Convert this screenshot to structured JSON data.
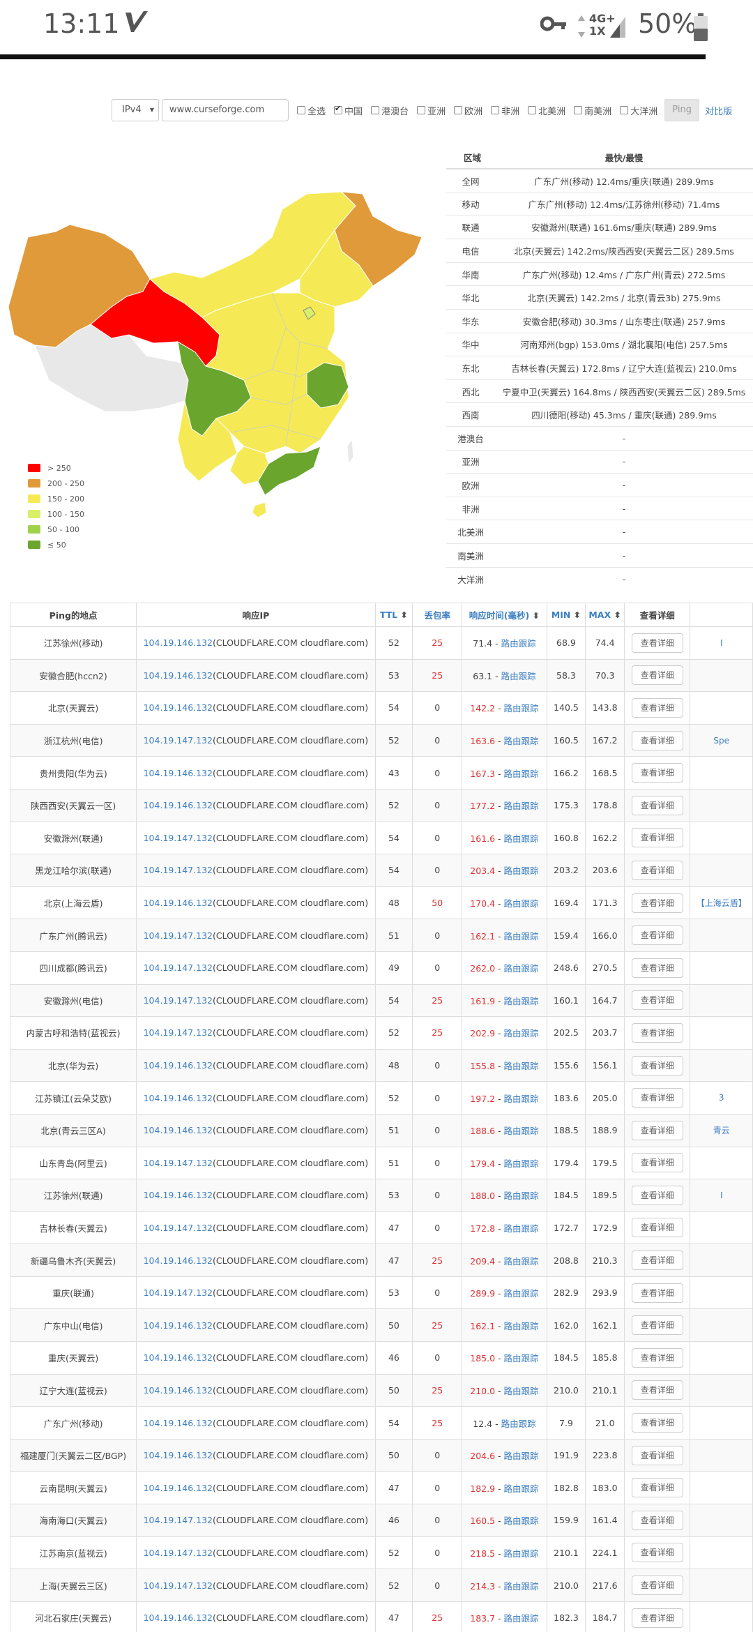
{
  "status_bar": {
    "time": "13:11",
    "network_top": "4G+",
    "network_bottom": "1X",
    "battery": "50%"
  },
  "controls": {
    "protocol": "IPv4",
    "url": "www.curseforge.com",
    "checkboxes": [
      {
        "label": "全选",
        "checked": false
      },
      {
        "label": "中国",
        "checked": true
      },
      {
        "label": "港澳台",
        "checked": false
      },
      {
        "label": "亚洲",
        "checked": false
      },
      {
        "label": "欧洲",
        "checked": false
      },
      {
        "label": "非洲",
        "checked": false
      },
      {
        "label": "北美洲",
        "checked": false
      },
      {
        "label": "南美洲",
        "checked": false
      },
      {
        "label": "大洋洲",
        "checked": false
      }
    ],
    "ping_button": "Ping",
    "compare_link": "对比版"
  },
  "colors": {
    "gt250": "#ff0000",
    "r200_250": "#e09a3a",
    "r150_200": "#f5ea55",
    "r100_150": "#d9ef6a",
    "r50_100": "#9ed24a",
    "le50": "#6aa52e",
    "nodata": "#e8e8e8"
  },
  "legend": [
    {
      "label": "> 250",
      "color_key": "gt250"
    },
    {
      "label": "200 - 250",
      "color_key": "r200_250"
    },
    {
      "label": "150 - 200",
      "color_key": "r150_200"
    },
    {
      "label": "100 - 150",
      "color_key": "r100_150"
    },
    {
      "label": "50 - 100",
      "color_key": "r50_100"
    },
    {
      "label": "≤ 50",
      "color_key": "le50"
    }
  ],
  "region_table": {
    "headers": [
      "区域",
      "最快/最慢"
    ],
    "rows": [
      {
        "region": "全网",
        "value": "广东广州(移动) 12.4ms/重庆(联通) 289.9ms"
      },
      {
        "region": "移动",
        "value": "广东广州(移动) 12.4ms/江苏徐州(移动) 71.4ms"
      },
      {
        "region": "联通",
        "value": "安徽滁州(联通) 161.6ms/重庆(联通) 289.9ms"
      },
      {
        "region": "电信",
        "value": "北京(天翼云) 142.2ms/陕西西安(天翼云二区) 289.5ms"
      },
      {
        "region": "华南",
        "value": "广东广州(移动) 12.4ms / 广东广州(青云) 272.5ms"
      },
      {
        "region": "华北",
        "value": "北京(天翼云) 142.2ms / 北京(青云3b) 275.9ms"
      },
      {
        "region": "华东",
        "value": "安徽合肥(移动) 30.3ms / 山东枣庄(联通) 257.9ms"
      },
      {
        "region": "华中",
        "value": "河南郑州(bgp) 153.0ms / 湖北襄阳(电信) 257.5ms"
      },
      {
        "region": "东北",
        "value": "吉林长春(天翼云) 172.8ms / 辽宁大连(蓝视云) 210.0ms"
      },
      {
        "region": "西北",
        "value": "宁夏中卫(天翼云) 164.8ms / 陕西西安(天翼云二区) 289.5ms"
      },
      {
        "region": "西南",
        "value": "四川德阳(移动) 45.3ms / 重庆(联通) 289.9ms"
      },
      {
        "region": "港澳台",
        "value": "-"
      },
      {
        "region": "亚洲",
        "value": "-"
      },
      {
        "region": "欧洲",
        "value": "-"
      },
      {
        "region": "非洲",
        "value": "-"
      },
      {
        "region": "北美洲",
        "value": "-"
      },
      {
        "region": "南美洲",
        "value": "-"
      },
      {
        "region": "大洋洲",
        "value": "-"
      }
    ]
  },
  "ping_table": {
    "headers": {
      "location": "Ping的地点",
      "ip": "响应IP",
      "ttl": "TTL",
      "loss": "丢包率",
      "time": "响应时间(毫秒)",
      "min": "MIN",
      "max": "MAX",
      "detail": "查看详细"
    },
    "trace_label": "路由跟踪",
    "detail_label": "查看详细",
    "rows": [
      {
        "loc": "江苏徐州(移动)",
        "ip": "104.19.146.132",
        "host": "(CLOUDFLARE.COM cloudflare.com)",
        "ttl": "52",
        "loss": "25",
        "time": "71.4",
        "min": "68.9",
        "max": "74.4",
        "extra": "I"
      },
      {
        "loc": "安徽合肥(hccn2)",
        "ip": "104.19.146.132",
        "host": "(CLOUDFLARE.COM cloudflare.com)",
        "ttl": "53",
        "loss": "25",
        "time": "63.1",
        "min": "58.3",
        "max": "70.3",
        "extra": ""
      },
      {
        "loc": "北京(天翼云)",
        "ip": "104.19.146.132",
        "host": "(CLOUDFLARE.COM cloudflare.com)",
        "ttl": "54",
        "loss": "0",
        "time": "142.2",
        "min": "140.5",
        "max": "143.8",
        "extra": ""
      },
      {
        "loc": "浙江杭州(电信)",
        "ip": "104.19.147.132",
        "host": "(CLOUDFLARE.COM cloudflare.com)",
        "ttl": "52",
        "loss": "0",
        "time": "163.6",
        "min": "160.5",
        "max": "167.2",
        "extra": "Spe"
      },
      {
        "loc": "贵州贵阳(华为云)",
        "ip": "104.19.146.132",
        "host": "(CLOUDFLARE.COM cloudflare.com)",
        "ttl": "43",
        "loss": "0",
        "time": "167.3",
        "min": "166.2",
        "max": "168.5",
        "extra": ""
      },
      {
        "loc": "陕西西安(天翼云一区)",
        "ip": "104.19.146.132",
        "host": "(CLOUDFLARE.COM cloudflare.com)",
        "ttl": "52",
        "loss": "0",
        "time": "177.2",
        "min": "175.3",
        "max": "178.8",
        "extra": ""
      },
      {
        "loc": "安徽滁州(联通)",
        "ip": "104.19.147.132",
        "host": "(CLOUDFLARE.COM cloudflare.com)",
        "ttl": "54",
        "loss": "0",
        "time": "161.6",
        "min": "160.8",
        "max": "162.2",
        "extra": ""
      },
      {
        "loc": "黑龙江哈尔滨(联通)",
        "ip": "104.19.147.132",
        "host": "(CLOUDFLARE.COM cloudflare.com)",
        "ttl": "54",
        "loss": "0",
        "time": "203.4",
        "min": "203.2",
        "max": "203.6",
        "extra": ""
      },
      {
        "loc": "北京(上海云盾)",
        "ip": "104.19.146.132",
        "host": "(CLOUDFLARE.COM cloudflare.com)",
        "ttl": "48",
        "loss": "50",
        "time": "170.4",
        "min": "169.4",
        "max": "171.3",
        "extra": "【上海云盾】"
      },
      {
        "loc": "广东广州(腾讯云)",
        "ip": "104.19.147.132",
        "host": "(CLOUDFLARE.COM cloudflare.com)",
        "ttl": "51",
        "loss": "0",
        "time": "162.1",
        "min": "159.4",
        "max": "166.0",
        "extra": ""
      },
      {
        "loc": "四川成都(腾讯云)",
        "ip": "104.19.147.132",
        "host": "(CLOUDFLARE.COM cloudflare.com)",
        "ttl": "49",
        "loss": "0",
        "time": "262.0",
        "min": "248.6",
        "max": "270.5",
        "extra": ""
      },
      {
        "loc": "安徽滁州(电信)",
        "ip": "104.19.147.132",
        "host": "(CLOUDFLARE.COM cloudflare.com)",
        "ttl": "54",
        "loss": "25",
        "time": "161.9",
        "min": "160.1",
        "max": "164.7",
        "extra": ""
      },
      {
        "loc": "内蒙古呼和浩特(蓝视云)",
        "ip": "104.19.147.132",
        "host": "(CLOUDFLARE.COM cloudflare.com)",
        "ttl": "52",
        "loss": "25",
        "time": "202.9",
        "min": "202.5",
        "max": "203.7",
        "extra": ""
      },
      {
        "loc": "北京(华为云)",
        "ip": "104.19.146.132",
        "host": "(CLOUDFLARE.COM cloudflare.com)",
        "ttl": "48",
        "loss": "0",
        "time": "155.8",
        "min": "155.6",
        "max": "156.1",
        "extra": ""
      },
      {
        "loc": "江苏镇江(云朵艾欧)",
        "ip": "104.19.146.132",
        "host": "(CLOUDFLARE.COM cloudflare.com)",
        "ttl": "52",
        "loss": "0",
        "time": "197.2",
        "min": "183.6",
        "max": "205.0",
        "extra": "3"
      },
      {
        "loc": "北京(青云三区A)",
        "ip": "104.19.146.132",
        "host": "(CLOUDFLARE.COM cloudflare.com)",
        "ttl": "51",
        "loss": "0",
        "time": "188.6",
        "min": "188.5",
        "max": "188.9",
        "extra": "青云"
      },
      {
        "loc": "山东青岛(阿里云)",
        "ip": "104.19.147.132",
        "host": "(CLOUDFLARE.COM cloudflare.com)",
        "ttl": "51",
        "loss": "0",
        "time": "179.4",
        "min": "179.4",
        "max": "179.5",
        "extra": ""
      },
      {
        "loc": "江苏徐州(联通)",
        "ip": "104.19.146.132",
        "host": "(CLOUDFLARE.COM cloudflare.com)",
        "ttl": "53",
        "loss": "0",
        "time": "188.0",
        "min": "184.5",
        "max": "189.5",
        "extra": "I"
      },
      {
        "loc": "吉林长春(天翼云)",
        "ip": "104.19.147.132",
        "host": "(CLOUDFLARE.COM cloudflare.com)",
        "ttl": "47",
        "loss": "0",
        "time": "172.8",
        "min": "172.7",
        "max": "172.9",
        "extra": ""
      },
      {
        "loc": "新疆乌鲁木齐(天翼云)",
        "ip": "104.19.146.132",
        "host": "(CLOUDFLARE.COM cloudflare.com)",
        "ttl": "47",
        "loss": "25",
        "time": "209.4",
        "min": "208.8",
        "max": "210.3",
        "extra": ""
      },
      {
        "loc": "重庆(联通)",
        "ip": "104.19.147.132",
        "host": "(CLOUDFLARE.COM cloudflare.com)",
        "ttl": "53",
        "loss": "0",
        "time": "289.9",
        "min": "282.9",
        "max": "293.9",
        "extra": ""
      },
      {
        "loc": "广东中山(电信)",
        "ip": "104.19.146.132",
        "host": "(CLOUDFLARE.COM cloudflare.com)",
        "ttl": "50",
        "loss": "25",
        "time": "162.1",
        "min": "162.0",
        "max": "162.1",
        "extra": ""
      },
      {
        "loc": "重庆(天翼云)",
        "ip": "104.19.146.132",
        "host": "(CLOUDFLARE.COM cloudflare.com)",
        "ttl": "46",
        "loss": "0",
        "time": "185.0",
        "min": "184.5",
        "max": "185.8",
        "extra": ""
      },
      {
        "loc": "辽宁大连(蓝视云)",
        "ip": "104.19.146.132",
        "host": "(CLOUDFLARE.COM cloudflare.com)",
        "ttl": "50",
        "loss": "25",
        "time": "210.0",
        "min": "210.0",
        "max": "210.1",
        "extra": ""
      },
      {
        "loc": "广东广州(移动)",
        "ip": "104.19.146.132",
        "host": "(CLOUDFLARE.COM cloudflare.com)",
        "ttl": "54",
        "loss": "25",
        "time": "12.4",
        "min": "7.9",
        "max": "21.0",
        "extra": ""
      },
      {
        "loc": "福建厦门(天翼云二区/BGP)",
        "ip": "104.19.146.132",
        "host": "(CLOUDFLARE.COM cloudflare.com)",
        "ttl": "50",
        "loss": "0",
        "time": "204.6",
        "min": "191.9",
        "max": "223.8",
        "extra": ""
      },
      {
        "loc": "云南昆明(天翼云)",
        "ip": "104.19.146.132",
        "host": "(CLOUDFLARE.COM cloudflare.com)",
        "ttl": "47",
        "loss": "0",
        "time": "182.9",
        "min": "182.8",
        "max": "183.0",
        "extra": ""
      },
      {
        "loc": "海南海口(天翼云)",
        "ip": "104.19.147.132",
        "host": "(CLOUDFLARE.COM cloudflare.com)",
        "ttl": "46",
        "loss": "0",
        "time": "160.5",
        "min": "159.9",
        "max": "161.4",
        "extra": ""
      },
      {
        "loc": "江苏南京(蓝视云)",
        "ip": "104.19.147.132",
        "host": "(CLOUDFLARE.COM cloudflare.com)",
        "ttl": "52",
        "loss": "0",
        "time": "218.5",
        "min": "210.1",
        "max": "224.1",
        "extra": ""
      },
      {
        "loc": "上海(天翼云三区)",
        "ip": "104.19.147.132",
        "host": "(CLOUDFLARE.COM cloudflare.com)",
        "ttl": "52",
        "loss": "0",
        "time": "214.3",
        "min": "210.0",
        "max": "217.6",
        "extra": ""
      },
      {
        "loc": "河北石家庄(天翼云)",
        "ip": "104.19.146.132",
        "host": "(CLOUDFLARE.COM cloudflare.com)",
        "ttl": "47",
        "loss": "25",
        "time": "183.7",
        "min": "182.3",
        "max": "184.7",
        "extra": ""
      }
    ]
  }
}
